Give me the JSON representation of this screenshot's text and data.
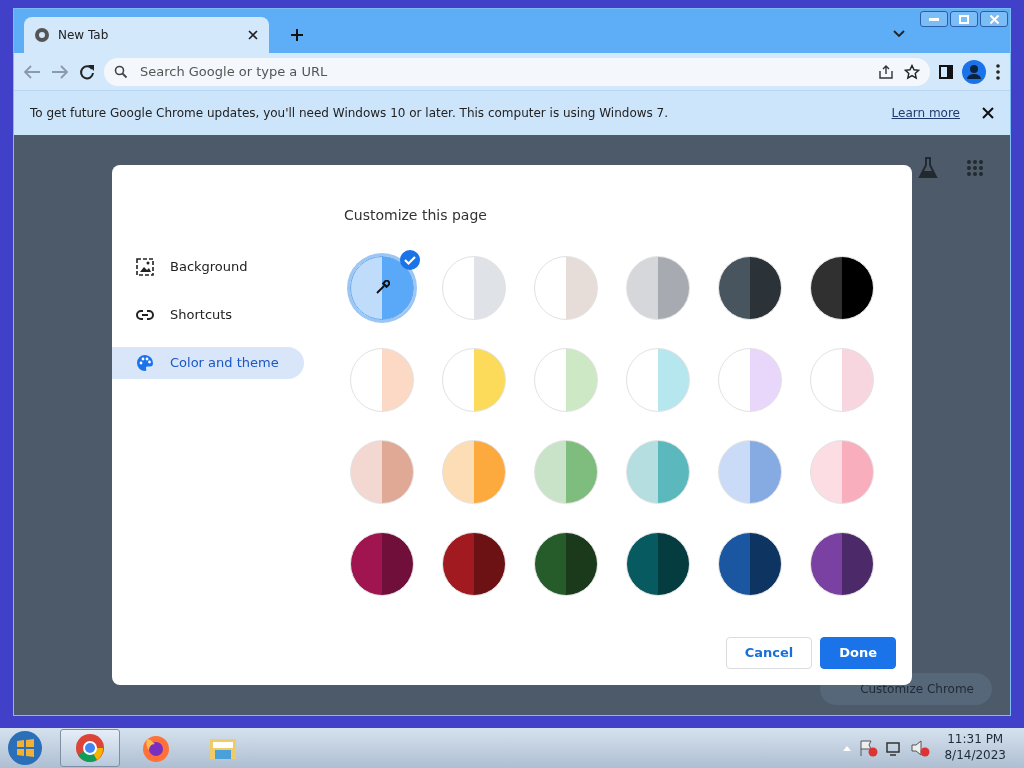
{
  "browser": {
    "tab_title": "New Tab",
    "search_placeholder": "Search Google or type a URL"
  },
  "infobar": {
    "message": "To get future Google Chrome updates, you'll need Windows 10 or later. This computer is using Windows 7.",
    "link": "Learn more"
  },
  "new_tab_page": {
    "customize_button": "Customize Chrome"
  },
  "dialog": {
    "title": "Customize this page",
    "menu": [
      {
        "label": "Background",
        "kind": "image",
        "selected": false
      },
      {
        "label": "Shortcuts",
        "kind": "link",
        "selected": false
      },
      {
        "label": "Color and theme",
        "kind": "palette",
        "selected": true
      }
    ],
    "swatches": [
      {
        "kind": "custom",
        "halves": [
          {
            "color": "#bfdcfb"
          },
          {
            "color": "#5aa8f8"
          }
        ],
        "selected": true
      },
      {
        "kind": "plain",
        "halves": [
          {
            "color": "#ffffff"
          },
          {
            "color": "#dfe3e7"
          }
        ],
        "selected": false
      },
      {
        "kind": "plain",
        "halves": [
          {
            "color": "#ffffff"
          },
          {
            "color": "#e6ddd9"
          }
        ],
        "selected": false
      },
      {
        "kind": "plain",
        "halves": [
          {
            "color": "#d6d7db"
          },
          {
            "color": "#a7aab1"
          }
        ],
        "selected": false
      },
      {
        "kind": "plain",
        "halves": [
          {
            "color": "#48545e"
          },
          {
            "color": "#2c3338"
          }
        ],
        "selected": false
      },
      {
        "kind": "plain",
        "halves": [
          {
            "color": "#303030"
          },
          {
            "color": "#000000"
          }
        ],
        "selected": false
      },
      {
        "kind": "plain",
        "halves": [
          {
            "color": "#ffffff"
          },
          {
            "color": "#fcd9c4"
          }
        ],
        "selected": false
      },
      {
        "kind": "plain",
        "halves": [
          {
            "color": "#ffffff"
          },
          {
            "color": "#fddb5a"
          }
        ],
        "selected": false
      },
      {
        "kind": "plain",
        "halves": [
          {
            "color": "#ffffff"
          },
          {
            "color": "#cde8c5"
          }
        ],
        "selected": false
      },
      {
        "kind": "plain",
        "halves": [
          {
            "color": "#ffffff"
          },
          {
            "color": "#b6e6ee"
          }
        ],
        "selected": false
      },
      {
        "kind": "plain",
        "halves": [
          {
            "color": "#ffffff"
          },
          {
            "color": "#e8d7fa"
          }
        ],
        "selected": false
      },
      {
        "kind": "plain",
        "halves": [
          {
            "color": "#ffffff"
          },
          {
            "color": "#f8d6e0"
          }
        ],
        "selected": false
      },
      {
        "kind": "plain",
        "halves": [
          {
            "color": "#f2d8d1"
          },
          {
            "color": "#e0a995"
          }
        ],
        "selected": false
      },
      {
        "kind": "plain",
        "halves": [
          {
            "color": "#fcddb5"
          },
          {
            "color": "#fca93e"
          }
        ],
        "selected": false
      },
      {
        "kind": "plain",
        "halves": [
          {
            "color": "#c8e3c8"
          },
          {
            "color": "#7fbd7e"
          }
        ],
        "selected": false
      },
      {
        "kind": "plain",
        "halves": [
          {
            "color": "#b4dedf"
          },
          {
            "color": "#5bb9be"
          }
        ],
        "selected": false
      },
      {
        "kind": "plain",
        "halves": [
          {
            "color": "#c9dbf7"
          },
          {
            "color": "#85abe2"
          }
        ],
        "selected": false
      },
      {
        "kind": "plain",
        "halves": [
          {
            "color": "#fcdde3"
          },
          {
            "color": "#f9aebe"
          }
        ],
        "selected": false
      },
      {
        "kind": "plain",
        "halves": [
          {
            "color": "#a0154f"
          },
          {
            "color": "#6f0f3a"
          }
        ],
        "selected": false
      },
      {
        "kind": "plain",
        "halves": [
          {
            "color": "#a11a1f"
          },
          {
            "color": "#6d1214"
          }
        ],
        "selected": false
      },
      {
        "kind": "plain",
        "halves": [
          {
            "color": "#265c2a"
          },
          {
            "color": "#1b3a1c"
          }
        ],
        "selected": false
      },
      {
        "kind": "plain",
        "halves": [
          {
            "color": "#075a5f"
          },
          {
            "color": "#053c40"
          }
        ],
        "selected": false
      },
      {
        "kind": "plain",
        "halves": [
          {
            "color": "#1a57a0"
          },
          {
            "color": "#0e3461"
          }
        ],
        "selected": false
      },
      {
        "kind": "plain",
        "halves": [
          {
            "color": "#7a40a2"
          },
          {
            "color": "#4c2a6a"
          }
        ],
        "selected": false
      }
    ],
    "buttons": [
      {
        "label": "Cancel",
        "kind": "secondary"
      },
      {
        "label": "Done",
        "kind": "primary"
      }
    ]
  },
  "taskbar": {
    "apps": [
      {
        "kind": "chrome",
        "selected": true
      },
      {
        "kind": "firefox",
        "selected": false
      },
      {
        "kind": "folder",
        "selected": false
      }
    ],
    "time": "11:31 PM",
    "date": "8/14/2023"
  }
}
